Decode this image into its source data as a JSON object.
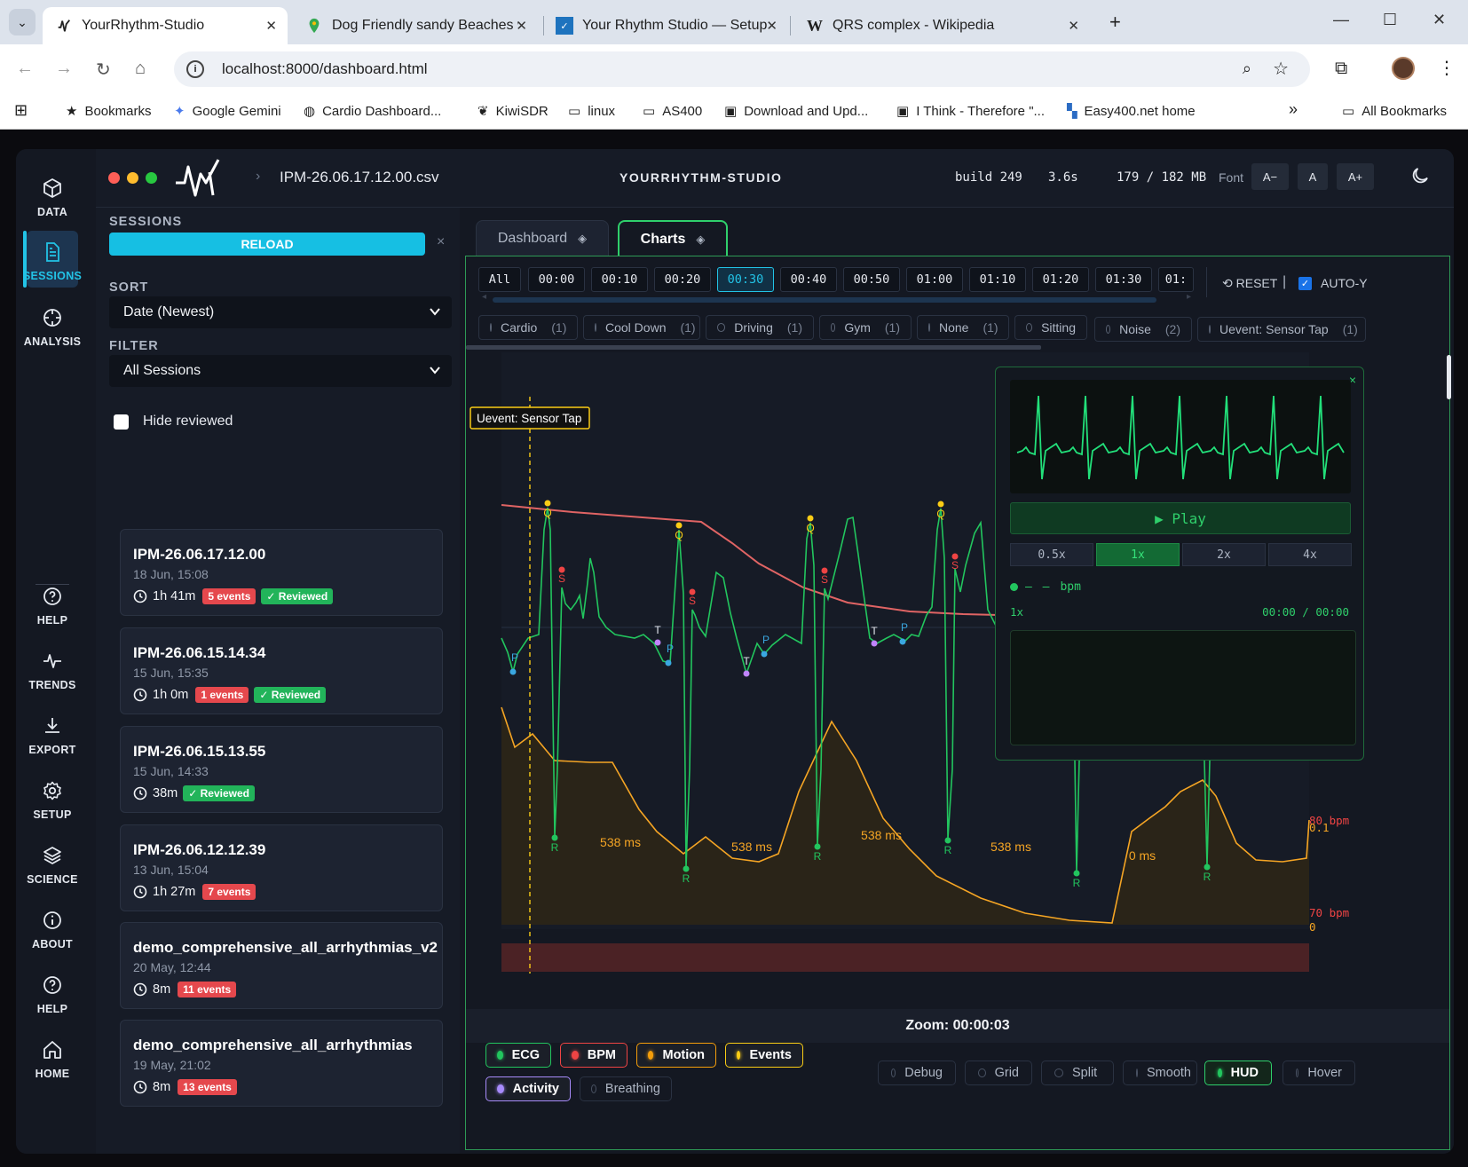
{
  "browser": {
    "tabs": [
      {
        "title": "YourRhythm-Studio",
        "active": true
      },
      {
        "title": "Dog Friendly sandy Beaches wi",
        "active": false
      },
      {
        "title": "Your Rhythm Studio — Setup",
        "active": false
      },
      {
        "title": "QRS complex - Wikipedia",
        "active": false
      }
    ],
    "url": "localhost:8000/dashboard.html",
    "bookmarks": [
      "Bookmarks",
      "Google Gemini",
      "Cardio Dashboard...",
      "KiwiSDR",
      "linux",
      "AS400",
      "Download and Upd...",
      "I Think - Therefore \"...",
      "Easy400.net home"
    ],
    "bookmarks_more": "»",
    "all_bookmarks": "All Bookmarks"
  },
  "rail": {
    "top": [
      {
        "label": "DATA",
        "icon": "cube-icon"
      },
      {
        "label": "SESSIONS",
        "icon": "document-icon",
        "active": true
      },
      {
        "label": "ANALYSIS",
        "icon": "crosshair-icon"
      }
    ],
    "bottom": [
      {
        "label": "HELP",
        "icon": "question-icon"
      },
      {
        "label": "TRENDS",
        "icon": "pulse-icon"
      },
      {
        "label": "EXPORT",
        "icon": "download-icon"
      },
      {
        "label": "SETUP",
        "icon": "gear-icon"
      },
      {
        "label": "SCIENCE",
        "icon": "layers-icon"
      },
      {
        "label": "ABOUT",
        "icon": "info-icon"
      },
      {
        "label": "HELP",
        "icon": "question-icon"
      },
      {
        "label": "HOME",
        "icon": "home-icon"
      }
    ]
  },
  "header": {
    "chevron": "›",
    "file": "IPM-26.06.17.12.00.csv",
    "title": "YOURRHYTHM-STUDIO",
    "build": "build 249",
    "time": "3.6s",
    "memory": "179 / 182 MB",
    "font_label": "Font",
    "font_buttons": [
      "A−",
      "A",
      "A+"
    ]
  },
  "sessions": {
    "heading": "SESSIONS",
    "reload": "RELOAD",
    "close": "×",
    "sort_label": "SORT",
    "sort_value": "Date (Newest)",
    "filter_label": "FILTER",
    "filter_value": "All Sessions",
    "hide_reviewed": "Hide reviewed",
    "cards": [
      {
        "name": "IPM-26.06.17.12.00",
        "date": "18 Jun, 15:08",
        "duration": "1h 41m",
        "events": "5 events",
        "reviewed": "✓ Reviewed"
      },
      {
        "name": "IPM-26.06.15.14.34",
        "date": "15 Jun, 15:35",
        "duration": "1h 0m",
        "events": "1 events",
        "reviewed": "✓ Reviewed"
      },
      {
        "name": "IPM-26.06.15.13.55",
        "date": "15 Jun, 14:33",
        "duration": "38m",
        "events": "",
        "reviewed": "✓ Reviewed"
      },
      {
        "name": "IPM-26.06.12.12.39",
        "date": "13 Jun, 15:04",
        "duration": "1h 27m",
        "events": "7 events",
        "reviewed": ""
      },
      {
        "name": "demo_comprehensive_all_arrhythmias_v2",
        "date": "20 May, 12:44",
        "duration": "8m",
        "events": "11 events",
        "reviewed": ""
      },
      {
        "name": "demo_comprehensive_all_arrhythmias",
        "date": "19 May, 21:02",
        "duration": "8m",
        "events": "13 events",
        "reviewed": ""
      }
    ]
  },
  "main_tabs": [
    {
      "label": "Dashboard",
      "active": false
    },
    {
      "label": "Charts",
      "active": true
    }
  ],
  "time_buttons": [
    "All",
    "00:00",
    "00:10",
    "00:20",
    "00:30",
    "00:40",
    "00:50",
    "01:00",
    "01:10",
    "01:20",
    "01:30",
    "01:"
  ],
  "time_active": "00:30",
  "reset": "⟲ RESET",
  "auto_y": "AUTO-Y",
  "activity_chips": [
    {
      "label": "Cardio",
      "count": "(1)"
    },
    {
      "label": "Cool Down",
      "count": "(1)"
    },
    {
      "label": "Driving",
      "count": "(1)"
    },
    {
      "label": "Gym",
      "count": "(1)"
    },
    {
      "label": "None",
      "count": "(1)"
    },
    {
      "label": "Sitting",
      "count": ""
    }
  ],
  "event_chips": [
    {
      "label": "Noise",
      "count": "(2)"
    },
    {
      "label": "Uevent: Sensor Tap",
      "count": "(1)"
    }
  ],
  "plot": {
    "event_label": "Uevent: Sensor Tap",
    "rr_labels": [
      "538 ms",
      "538 ms",
      "538 ms",
      "538 ms",
      "0 ms"
    ],
    "right_labels": [
      "80 bpm",
      "0.1",
      "70 bpm",
      "0"
    ],
    "wave_labels": {
      "R": "R",
      "Q": "Q",
      "S": "S",
      "T": "T",
      "P": "P"
    }
  },
  "hud": {
    "close": "×",
    "play": "▶  Play",
    "speeds": [
      "0.5x",
      "1x",
      "2x",
      "4x"
    ],
    "speed_active": "1x",
    "bpm_label": "bpm",
    "rate": "1x",
    "time": "00:00 / 00:00"
  },
  "zoom": "Zoom: 00:00:03",
  "legend": [
    {
      "label": "ECG",
      "color": "#22c55e",
      "on": true
    },
    {
      "label": "BPM",
      "color": "#ef4444",
      "on": true
    },
    {
      "label": "Motion",
      "color": "#f59e0b",
      "on": true
    },
    {
      "label": "Events",
      "color": "#facc15",
      "on": true
    },
    {
      "label": "Activity",
      "color": "#a78bfa",
      "on": true
    },
    {
      "label": "Breathing",
      "color": "#4a5364",
      "on": false
    }
  ],
  "options": [
    {
      "label": "Debug",
      "on": false
    },
    {
      "label": "Grid",
      "on": false
    },
    {
      "label": "Split",
      "on": false
    },
    {
      "label": "Smooth",
      "on": false
    },
    {
      "label": "HUD",
      "on": true
    },
    {
      "label": "Hover",
      "on": false
    }
  ],
  "colors": {
    "accent": "#22c3e6",
    "ecg": "#22c55e",
    "bpm": "#e06464",
    "motion": "#f5a524",
    "event": "#facc15",
    "badge_events": "#e5484d",
    "badge_reviewed": "#22b45a"
  }
}
